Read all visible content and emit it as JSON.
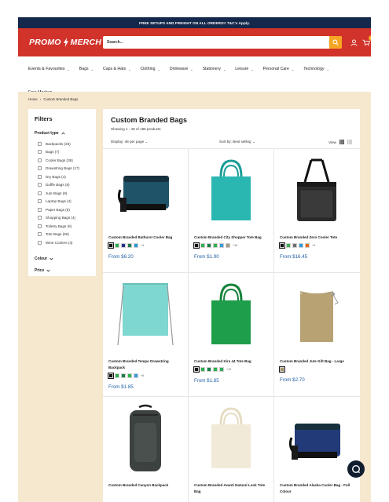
{
  "announcement": "FREE SETUPS AND FREIGHT ON ALL ORDERS!! T&C's Apply.",
  "brand": {
    "logo_left": "PROMO",
    "logo_right": "MERCH",
    "primary": "#d1322a",
    "accent": "#f6a623",
    "navy": "#14284b",
    "price_color": "#1f5fa6"
  },
  "search": {
    "placeholder": "Search..."
  },
  "cart": {
    "count": "0"
  },
  "nav": {
    "items": [
      "Events & Favourites",
      "Bags",
      "Caps & Hats",
      "Clothing",
      "Drinkware",
      "Stationery",
      "Leisure",
      "Personal Care",
      "Technology"
    ],
    "extra": "Free Mockup"
  },
  "breadcrumb": {
    "home": "Home",
    "current": "Custom Branded Bags"
  },
  "filters": {
    "title": "Filters",
    "product_type_label": "Product type",
    "product_types": [
      "Backpacks (25)",
      "Bags (7)",
      "Cooler Bags (39)",
      "Drawstring Bags (17)",
      "Dry Bags (4)",
      "Duffle Bags (6)",
      "Jute Bags (9)",
      "Laptop Bags (4)",
      "Paper Bags (9)",
      "Shopping Bags (4)",
      "Toiletry Bags (6)",
      "Tote Bags (60)",
      "Wine Coolers (4)"
    ],
    "colour_label": "Colour",
    "price_label": "Price"
  },
  "collection": {
    "title": "Custom Branded Bags",
    "showing": "Showing 1 - 48 of 196 products",
    "per_page": "Display: 48 per page",
    "sort": "Sort by: Best selling",
    "view_label": "View"
  },
  "products": [
    {
      "name": "Custom Branded Bathurst Cooler Bag",
      "price": "From $6.20",
      "icon": "cooler-bag",
      "swatches": [
        "#111111",
        "#2fae4e",
        "#27348b",
        "#1e7e4a",
        "#2b9bd8"
      ],
      "more": "+4"
    },
    {
      "name": "Custom Branded City Shopper Tote Bag",
      "price": "From $1.90",
      "icon": "tote-bag",
      "swatches": [
        "#111111",
        "#2fae4e",
        "#1e7e4a",
        "#2bb34a",
        "#3a9ad9",
        "#a49a86"
      ],
      "more": "+10"
    },
    {
      "name": "Custom Branded Zero Cooler Tote",
      "price": "From $16.45",
      "icon": "cooler-tote",
      "swatches": [
        "#111111",
        "#3cae52",
        "#6f6f6f",
        "#2b9bd8",
        "#e36a1f"
      ],
      "more": "+4"
    },
    {
      "name": "Custom Branded Tempo Drawstring Backpack",
      "price": "From $1.85",
      "icon": "drawstring-bag",
      "swatches": [
        "#111111",
        "#2fae4e",
        "#1e7e4a",
        "#2bb34a",
        "#3a9ad9"
      ],
      "more": "+6"
    },
    {
      "name": "Custom Branded Kira 44 Tote Bag",
      "price": "From $1.85",
      "icon": "tote-bag",
      "swatches": [
        "#111111",
        "#2fae4e",
        "#1e7e4a",
        "#2bb34a",
        "#3aa85b"
      ],
      "more": "+12"
    },
    {
      "name": "Custom Branded Jute Gift Bag - Large",
      "price": "From $2.70",
      "icon": "jute-bag",
      "swatches": [
        "#a6956b"
      ],
      "more": ""
    },
    {
      "name": "Custom Branded Canyon Backpack",
      "price": "",
      "icon": "backpack",
      "swatches": [],
      "more": ""
    },
    {
      "name": "Custom Branded Avanti Natural Look Tote Bag",
      "price": "",
      "icon": "tote-bag",
      "swatches": [],
      "more": ""
    },
    {
      "name": "Custom Branded Alaska Cooler Bag - Full Colour",
      "price": "",
      "icon": "cooler-bag",
      "swatches": [],
      "more": ""
    }
  ]
}
